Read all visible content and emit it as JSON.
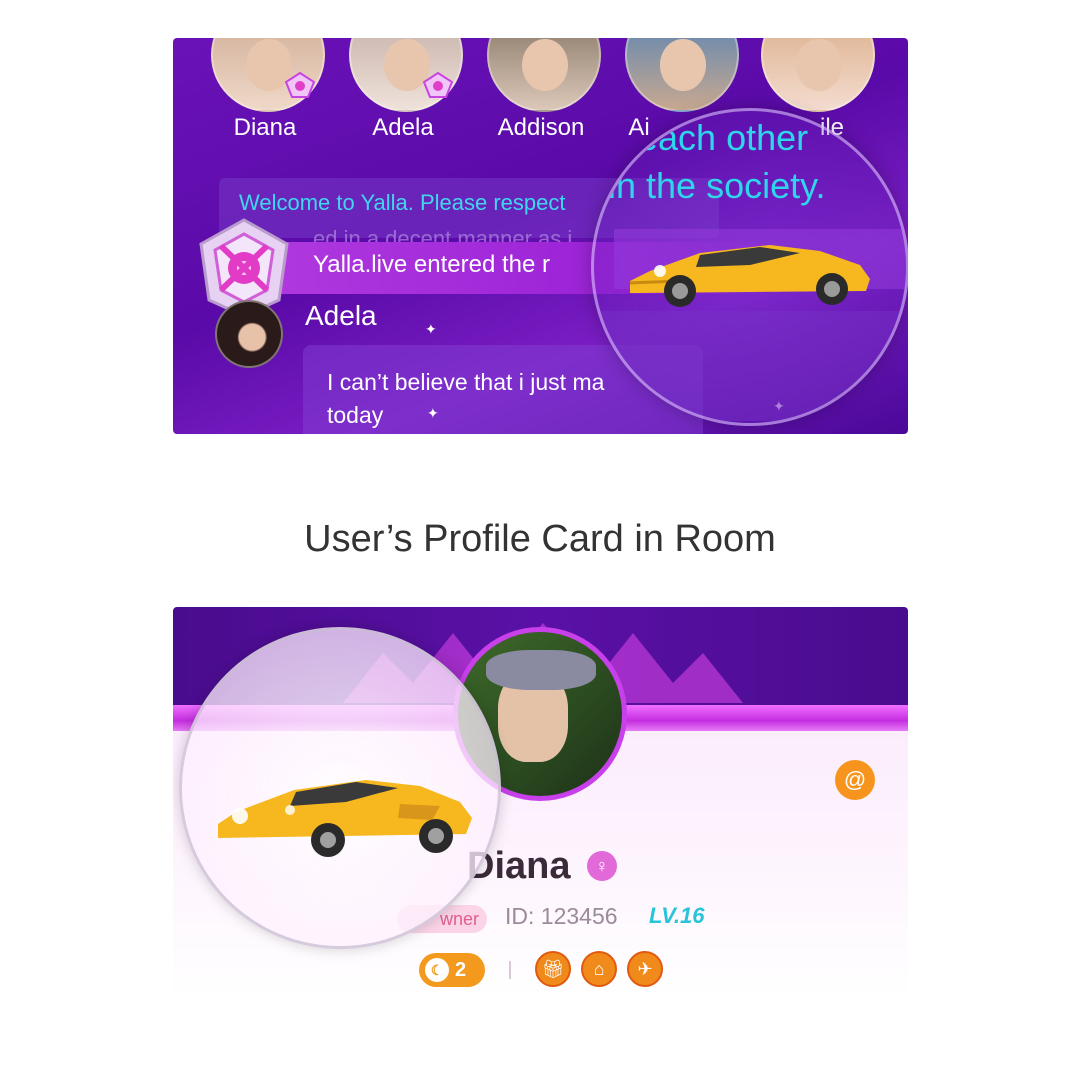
{
  "room": {
    "avatars": [
      {
        "name": "Diana"
      },
      {
        "name": "Adela"
      },
      {
        "name": "Addison"
      },
      {
        "name": "Ai"
      },
      {
        "name": "ile"
      }
    ],
    "welcome_text": "Welcome to Yalla. Please respect",
    "faded_text": "ed in a decent manner as i",
    "entered_text": "Yalla.live entered the r",
    "chat_user": "Adela",
    "chat_message": "I can’t believe that i just ma today",
    "magnifier_line1": "each other",
    "magnifier_line2": "in the society."
  },
  "caption": "User’s Profile Card in Room",
  "profile": {
    "name": "Diana",
    "role_tag": "wner",
    "id_text": "ID: 123456",
    "level_text": "LV.16",
    "at_symbol": "@",
    "coin_count": "2"
  },
  "icons": [
    "gift-icon",
    "house-icon",
    "helicopter-icon",
    "moon-icon",
    "at-icon",
    "female-icon",
    "rank-badge-icon",
    "sports-car-icon"
  ],
  "colors": {
    "room_purple": "#5a0aa8",
    "cyan_text": "#3fd6ee",
    "profile_pink": "#fbe6fb",
    "accent_orange": "#f7941d",
    "level_cyan": "#29c4d8"
  }
}
